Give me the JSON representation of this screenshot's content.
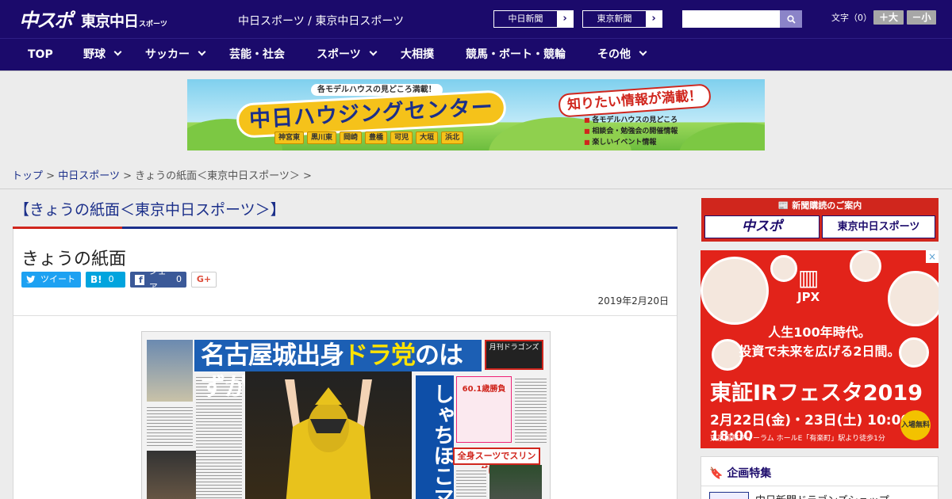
{
  "header": {
    "logo_chuspo": "中スポ",
    "logo_tokyo": "東京中日",
    "logo_sports": "スポーツ",
    "site_name": "中日スポーツ / 東京中日スポーツ",
    "ext_links": [
      "中日新聞",
      "東京新聞"
    ],
    "search_placeholder": "",
    "font_label": "文字（0）",
    "font_bigger": "＋大",
    "font_smaller": "－小",
    "bg_color": "#1b0a6b"
  },
  "nav": {
    "items": [
      {
        "label": "TOP",
        "dropdown": false
      },
      {
        "label": "野球",
        "dropdown": true
      },
      {
        "label": "サッカー",
        "dropdown": true
      },
      {
        "label": "芸能・社会",
        "dropdown": false
      },
      {
        "label": "スポーツ",
        "dropdown": true
      },
      {
        "label": "大相撲",
        "dropdown": false
      },
      {
        "label": "競馬・ボート・競輪",
        "dropdown": false
      },
      {
        "label": "その他",
        "dropdown": true
      }
    ]
  },
  "banner": {
    "top_copy": "各モデルハウスの見どころ満載！",
    "title": "中日ハウジングセンター",
    "want": "知りたい情報が満載！",
    "cities": [
      "神宮東",
      "黒川東",
      "岡崎",
      "豊橋",
      "可児",
      "大垣",
      "浜北"
    ],
    "info": [
      "各モデルハウスの見どころ",
      "相談会・勉強会の開催情報",
      "楽しいイベント情報"
    ]
  },
  "breadcrumb": {
    "home": "トップ",
    "sep": ">",
    "section": "中日スポーツ",
    "current": "きょうの紙面＜東京中日スポーツ＞ >"
  },
  "article": {
    "heading": "【きょうの紙面＜東京中日スポーツ＞】",
    "title": "きょうの紙面",
    "date": "2019年2月20日",
    "share": {
      "tweet": "ツイート",
      "hatena_count": "0",
      "fb_label": "シェア",
      "fb_count": "0",
      "gplus": "G+"
    },
    "paper": {
      "headline_a": "名古屋城出身",
      "headline_b": "ドラ党",
      "headline_c": "のはずが…",
      "vertical": "しゃちほこマ",
      "red_band": "全身スーツでスリングに登場",
      "pink_box": "60.1歳勝負",
      "dragons": "月刊ドラゴンズ"
    }
  },
  "sidebar": {
    "subscribe_title": "新聞購読のご案内",
    "subscribe_items": [
      "中スポ",
      "東京中日スポーツ"
    ],
    "ad": {
      "brand": "JPX",
      "copy": [
        "人生100年時代。",
        "投資で未来を広げる2日間。"
      ],
      "title": "東証IRフェスタ2019",
      "dates": "2月22日(金)・23日(土) 10:00～18:00",
      "venue": "東京国際フォーラム ホールE「有楽町」駅より徒歩1分",
      "free": "入場無料",
      "close": "×"
    },
    "feature_title": "企画特集",
    "feature_item": "中日新聞ドラゴンズショップ"
  }
}
